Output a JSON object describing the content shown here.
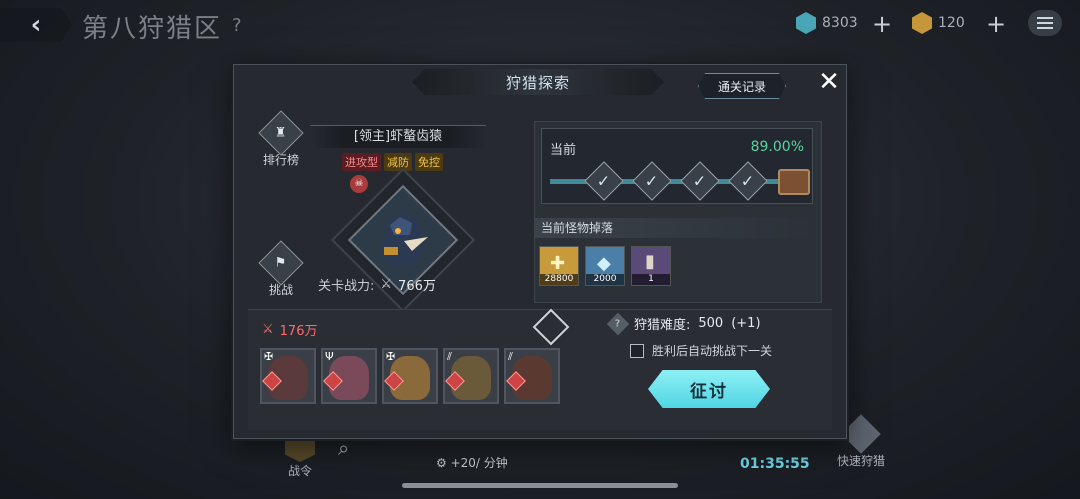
{
  "header": {
    "back_icon": "back-arrow-icon",
    "zone_title": "第八狩猎区",
    "help_label": "?",
    "resources": [
      {
        "icon": "crystal-icon",
        "value": "8303",
        "color": "#4aa6b6"
      },
      {
        "icon": "shield-coin-icon",
        "value": "120",
        "color": "#c5963a"
      }
    ],
    "plus_label": "+",
    "menu_icon": "menu-icon"
  },
  "dialog": {
    "title": "狩猎探索",
    "record_button": "通关记录",
    "close_label": "✕",
    "ranking_label": "排行榜",
    "challenge_label": "挑战",
    "boss_name": "[领主]虾螯齿猿",
    "boss_tags": [
      "进攻型",
      "减防",
      "免控"
    ],
    "stage_power_label": "关卡战力:",
    "stage_power_value": "766万",
    "progress": {
      "label": "当前",
      "percent": "89.00%",
      "fraction": 0.89,
      "completed_steps": 4,
      "total_steps": 5
    },
    "drops_label": "当前怪物掉落",
    "drops": [
      {
        "icon": "gold-cross-icon",
        "quantity": "28800",
        "color": "#c79a3a"
      },
      {
        "icon": "blue-crystal-icon",
        "quantity": "2000",
        "color": "#4b7fa8"
      },
      {
        "icon": "bullet-icon",
        "quantity": "1",
        "color": "#5a4a7a"
      }
    ],
    "team_power": "176万",
    "team_members": [
      {
        "name": "member-1",
        "color": "#5a3a3a"
      },
      {
        "name": "member-2",
        "color": "#7a4a5a"
      },
      {
        "name": "member-3",
        "color": "#8a6a3a"
      },
      {
        "name": "member-4",
        "color": "#6a5a3a"
      },
      {
        "name": "member-5",
        "color": "#5a3a30"
      }
    ],
    "difficulty_label": "狩猎难度:",
    "difficulty_value": "500",
    "difficulty_bonus": "(+1)",
    "auto_next_label": "胜利后自动挑战下一关",
    "attack_button": "征讨"
  },
  "footer": {
    "battle_pass_label": "战令",
    "rate": "+20/ 分钟",
    "timer": "01:35:55",
    "quick_hunt_label": "快速狩猎"
  }
}
